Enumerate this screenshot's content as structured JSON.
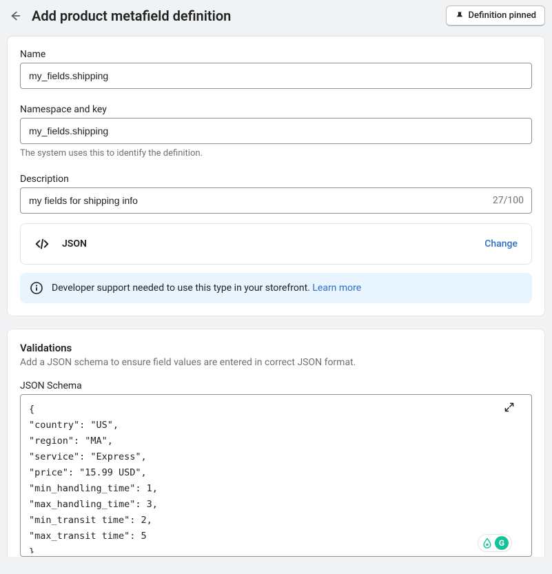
{
  "header": {
    "title": "Add product metafield definition",
    "pinned_label": "Definition pinned"
  },
  "form": {
    "name_label": "Name",
    "name_value": "my_fields.shipping",
    "namespace_label": "Namespace and key",
    "namespace_value": "my_fields.shipping",
    "namespace_help": "The system uses this to identify the definition.",
    "description_label": "Description",
    "description_value": "my fields for shipping info",
    "description_count": "27/100",
    "type_name": "JSON",
    "change_label": "Change",
    "banner_text": "Developer support needed to use this type in your storefront. ",
    "banner_link": "Learn more"
  },
  "validations": {
    "heading": "Validations",
    "subtext": "Add a JSON schema to ensure field values are entered in correct JSON format.",
    "schema_label": "JSON Schema",
    "schema_value": "{\n\"country\": \"US\",\n\"region\": \"MA\",\n\"service\": \"Express\",\n\"price\": \"15.99 USD\",\n\"min_handling_time\": 1,\n\"max_handling_time\": 3,\n\"min_transit time\": 2,\n\"max_transit time\": 5\n}"
  }
}
